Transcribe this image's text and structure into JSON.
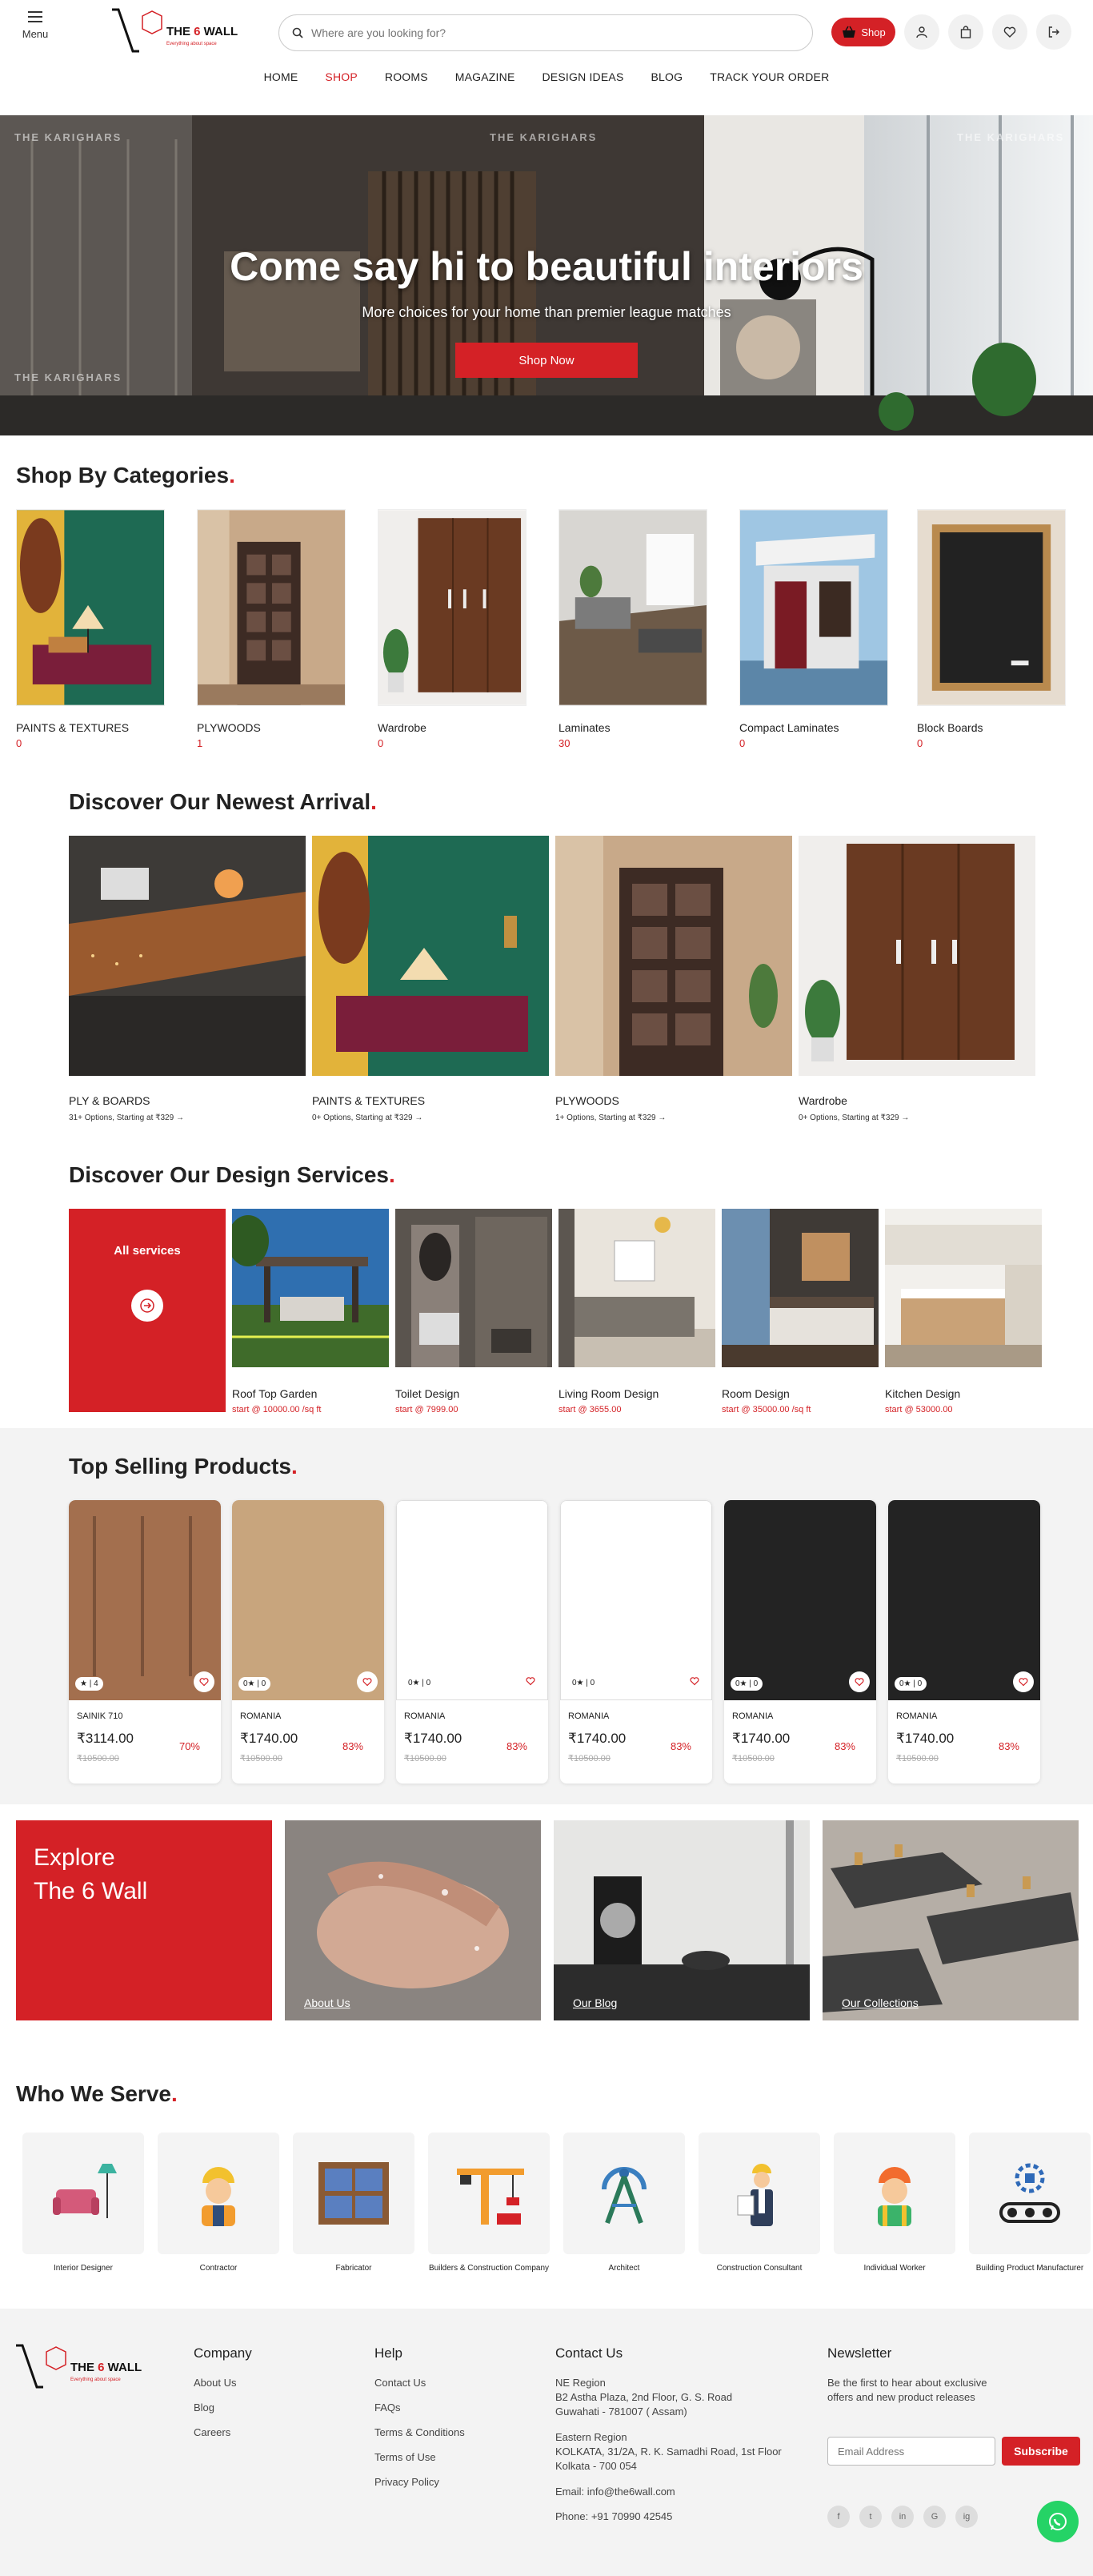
{
  "header": {
    "menu_label": "Menu",
    "logo_brand": "THE 6 WALL",
    "logo_tagline": "Everything about space",
    "search_placeholder": "Where are you looking for?",
    "shop_label": "Shop",
    "nav": [
      "HOME",
      "SHOP",
      "ROOMS",
      "MAGAZINE",
      "DESIGN IDEAS",
      "BLOG",
      "TRACK YOUR ORDER"
    ],
    "active_nav": "SHOP"
  },
  "hero": {
    "title": "Come say hi to beautiful interiors",
    "subtitle": "More choices for your home than premier league matches",
    "cta": "Shop Now",
    "watermark": "THE KARIGHARS"
  },
  "categories": {
    "title": "Shop By Categories",
    "items": [
      {
        "name": "PAINTS & TEXTURES",
        "count": "0"
      },
      {
        "name": "PLYWOODS",
        "count": "1"
      },
      {
        "name": "Wardrobe",
        "count": "0"
      },
      {
        "name": "Laminates",
        "count": "30"
      },
      {
        "name": "Compact Laminates",
        "count": "0"
      },
      {
        "name": "Block Boards",
        "count": "0"
      }
    ]
  },
  "arrivals": {
    "title": "Discover Our Newest Arrival",
    "items": [
      {
        "name": "PLY & BOARDS",
        "sub": "31+ Options, Starting at ₹329 →"
      },
      {
        "name": "PAINTS & TEXTURES",
        "sub": "0+ Options, Starting at ₹329 →"
      },
      {
        "name": "PLYWOODS",
        "sub": "1+ Options, Starting at ₹329 →"
      },
      {
        "name": "Wardrobe",
        "sub": "0+ Options, Starting at ₹329 →"
      }
    ]
  },
  "services": {
    "title": "Discover Our Design Services",
    "all_label": "All services",
    "items": [
      {
        "name": "Roof Top Garden",
        "price": "start @ 10000.00 /sq ft"
      },
      {
        "name": "Toilet Design",
        "price": "start @ 7999.00"
      },
      {
        "name": "Living Room Design",
        "price": "start @ 3655.00"
      },
      {
        "name": "Room Design",
        "price": "start @ 35000.00 /sq ft"
      },
      {
        "name": "Kitchen Design",
        "price": "start @ 53000.00"
      }
    ]
  },
  "top_selling": {
    "title": "Top Selling Products",
    "items": [
      {
        "rating": "★ | 4",
        "brand": "SAINIK 710",
        "price": "₹3114.00",
        "off": "70%",
        "mrp": "₹10500.00",
        "swatch": "#a36f4e"
      },
      {
        "rating": "0★ | 0",
        "brand": "ROMANIA",
        "price": "₹1740.00",
        "off": "83%",
        "mrp": "₹10500.00",
        "swatch": "#c8a57d"
      },
      {
        "rating": "0★ | 0",
        "brand": "ROMANIA",
        "price": "₹1740.00",
        "off": "83%",
        "mrp": "₹10500.00",
        "swatch": "#ffffff"
      },
      {
        "rating": "0★ | 0",
        "brand": "ROMANIA",
        "price": "₹1740.00",
        "off": "83%",
        "mrp": "₹10500.00",
        "swatch": "#ffffff"
      },
      {
        "rating": "0★ | 0",
        "brand": "ROMANIA",
        "price": "₹1740.00",
        "off": "83%",
        "mrp": "₹10500.00",
        "swatch": "#232323"
      },
      {
        "rating": "0★ | 0",
        "brand": "ROMANIA",
        "price": "₹1740.00",
        "off": "83%",
        "mrp": "₹10500.00",
        "swatch": "#232323"
      }
    ]
  },
  "explore": {
    "line1": "Explore",
    "line2": "The 6 Wall",
    "links": [
      "About Us",
      "Our Blog",
      "Our Collections"
    ]
  },
  "serve": {
    "title": "Who We Serve",
    "items": [
      "Interior Designer",
      "Contractor",
      "Fabricator",
      "Builders & Construction Company",
      "Architect",
      "Construction Consultant",
      "Individual Worker",
      "Building Product Manufacturer"
    ]
  },
  "footer": {
    "company_title": "Company",
    "company_links": [
      "About Us",
      "Blog",
      "Careers"
    ],
    "help_title": "Help",
    "help_links": [
      "Contact Us",
      "FAQs",
      "Terms & Conditions",
      "Terms of Use",
      "Privacy Policy"
    ],
    "contact_title": "Contact Us",
    "ne_region": "NE Region",
    "ne_addr1": "B2 Astha Plaza, 2nd Floor, G. S. Road",
    "ne_addr2": "Guwahati - 781007 ( Assam)",
    "e_region": "Eastern Region",
    "e_addr1": "KOLKATA, 31/2A, R. K. Samadhi Road, 1st Floor",
    "e_addr2": "Kolkata - 700 054",
    "email": "Email: info@the6wall.com",
    "phone": "Phone: +91 70990 42545",
    "newsletter_title": "Newsletter",
    "newsletter_text1": "Be the first to hear about exclusive",
    "newsletter_text2": "offers and new product releases",
    "email_placeholder": "Email Address",
    "subscribe": "Subscribe",
    "social": [
      "f",
      "t",
      "in",
      "G",
      "ig"
    ]
  },
  "colors": {
    "accent": "#d42126",
    "whatsapp": "#25d366"
  }
}
